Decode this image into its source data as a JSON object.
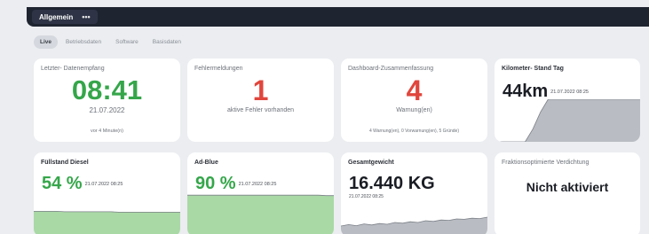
{
  "topbar": {
    "tab": "Allgemein",
    "menu_glyph": "•••"
  },
  "subtabs": [
    {
      "label": "Live",
      "active": true
    },
    {
      "label": "Betriebsdaten",
      "active": false
    },
    {
      "label": "Software",
      "active": false
    },
    {
      "label": "Basisdaten",
      "active": false
    }
  ],
  "cards": {
    "last_receive": {
      "label": "Letzter- Datenempfang",
      "time": "08:41",
      "date": "21.07.2022",
      "ago": "vor 4 Minute(n)"
    },
    "errors": {
      "label": "Fehlermeldungen",
      "count": "1",
      "text": "aktive Fehler vorhanden"
    },
    "dashboard": {
      "label": "Dashboard-Zusammenfassung",
      "count": "4",
      "text": "Warnung(en)",
      "detail": "4 Warnung(en), 0 Vorwarnung(en), 5 Gründe)"
    },
    "km": {
      "label": "Kilometer- Stand Tag",
      "value": "44km",
      "timestamp": "21.07.2022 08:25",
      "fill_color": "#b9bcc2",
      "series": [
        0,
        0,
        0,
        0,
        0,
        0.3,
        0.7,
        1,
        1,
        1,
        1,
        1,
        1,
        1,
        1,
        1,
        1,
        1,
        1,
        1
      ]
    },
    "diesel": {
      "label": "Füllstand Diesel",
      "value": "54 %",
      "timestamp": "21.07.2022 08:25",
      "fill_color": "#a9d9a5",
      "series": [
        0.55,
        0.55,
        0.55,
        0.55,
        0.54,
        0.54,
        0.54,
        0.54,
        0.54,
        0.54,
        0.54,
        0.53,
        0.53,
        0.53,
        0.53,
        0.53,
        0.53,
        0.53,
        0.53,
        0.53
      ]
    },
    "adblue": {
      "label": "Ad-Blue",
      "value": "90 %",
      "timestamp": "21.07.2022 08:25",
      "fill_color": "#a9d9a5",
      "series": [
        0.9,
        0.9,
        0.9,
        0.9,
        0.9,
        0.9,
        0.9,
        0.9,
        0.9,
        0.9,
        0.9,
        0.9,
        0.9,
        0.9,
        0.9,
        0.9,
        0.9,
        0.9,
        0.89,
        0.89
      ]
    },
    "weight": {
      "label": "Gesamtgewicht",
      "value": "16.440 KG",
      "timestamp": "21.07.2022 08:25",
      "fill_color": "#b9bcc2",
      "series": [
        0.3,
        0.34,
        0.31,
        0.36,
        0.33,
        0.37,
        0.35,
        0.4,
        0.38,
        0.42,
        0.4,
        0.45,
        0.43,
        0.47,
        0.46,
        0.5,
        0.49,
        0.52,
        0.51,
        0.55
      ]
    },
    "fraction": {
      "label": "Fraktionsoptimierte Verdichtung",
      "status": "Nicht aktiviert"
    }
  }
}
